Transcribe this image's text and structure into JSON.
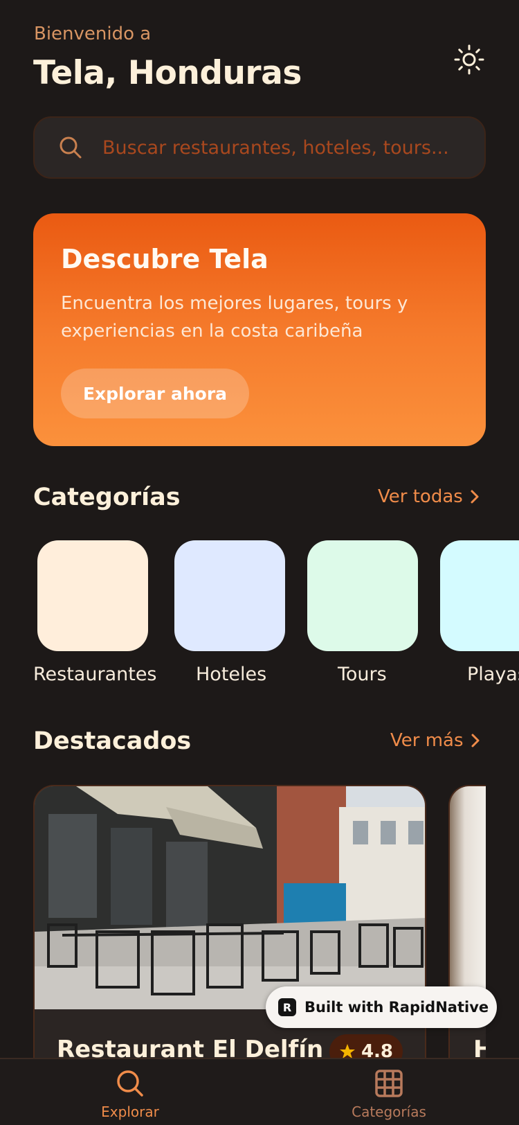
{
  "header": {
    "greeting": "Bienvenido a",
    "city": "Tela, Honduras",
    "theme_icon": "sun-icon"
  },
  "search": {
    "placeholder": "Buscar restaurantes, hoteles, tours..."
  },
  "hero": {
    "title": "Descubre Tela",
    "description": "Encuentra los mejores lugares, tours y experiencias en la costa caribeña",
    "cta": "Explorar ahora"
  },
  "categories": {
    "title": "Categorías",
    "link": "Ver todas",
    "items": [
      {
        "label": "Restaurantes",
        "color": "#ffeedb"
      },
      {
        "label": "Hoteles",
        "color": "#dfe9ff"
      },
      {
        "label": "Tours",
        "color": "#ddfae9"
      },
      {
        "label": "Playas",
        "color": "#d4fbff"
      }
    ]
  },
  "featured": {
    "title": "Destacados",
    "link": "Ver más",
    "cards": [
      {
        "name": "Restaurant El Delfín",
        "rating": "4.8"
      },
      {
        "name": "H"
      }
    ]
  },
  "badge": {
    "text": "Built with RapidNative"
  },
  "nav": {
    "items": [
      {
        "label": "Explorar",
        "icon": "search-icon",
        "active": true,
        "color": "#f08c4a"
      },
      {
        "label": "Categorías",
        "icon": "grid-icon",
        "active": false,
        "color": "#b87a5c"
      }
    ]
  },
  "colors": {
    "background": "#1d1918",
    "accent": "#f08c4a",
    "hero_start": "#ea5a12",
    "hero_end": "#fb913c"
  }
}
